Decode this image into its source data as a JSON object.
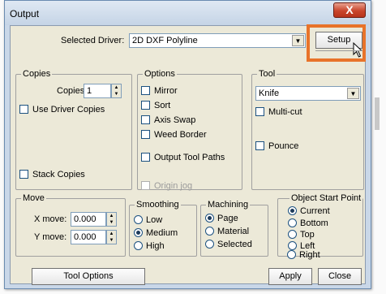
{
  "window": {
    "title": "Output",
    "close_glyph": "X"
  },
  "driver": {
    "label": "Selected Driver:",
    "value": "2D DXF Polyline",
    "setup_label": "Setup"
  },
  "copies": {
    "group_title": "Copies",
    "copies_label": "Copies:",
    "copies_value": "1",
    "use_driver_copies": "Use Driver Copies",
    "stack_copies": "Stack Copies"
  },
  "options": {
    "group_title": "Options",
    "items": [
      "Mirror",
      "Sort",
      "Axis Swap",
      "Weed Border",
      "Output Tool Paths",
      "Origin jog"
    ]
  },
  "tool": {
    "group_title": "Tool",
    "value": "Knife",
    "multi_cut": "Multi-cut",
    "pounce": "Pounce"
  },
  "move": {
    "group_title": "Move",
    "x_label": "X move:",
    "x_value": "0.000",
    "y_label": "Y move:",
    "y_value": "0.000"
  },
  "smoothing": {
    "group_title": "Smoothing",
    "options": [
      "Low",
      "Medium",
      "High"
    ],
    "selected": "Medium"
  },
  "machining": {
    "group_title": "Machining",
    "options": [
      "Page",
      "Material",
      "Selected"
    ],
    "selected": "Page"
  },
  "start_point": {
    "group_title": "Object Start Point",
    "options": [
      "Current",
      "Bottom",
      "Top",
      "Left",
      "Right"
    ],
    "selected": "Current"
  },
  "buttons": {
    "tool_options": "Tool Options",
    "apply": "Apply",
    "close": "Close"
  },
  "colors": {
    "highlight": "#e8732a",
    "close_button": "#c9452b"
  }
}
